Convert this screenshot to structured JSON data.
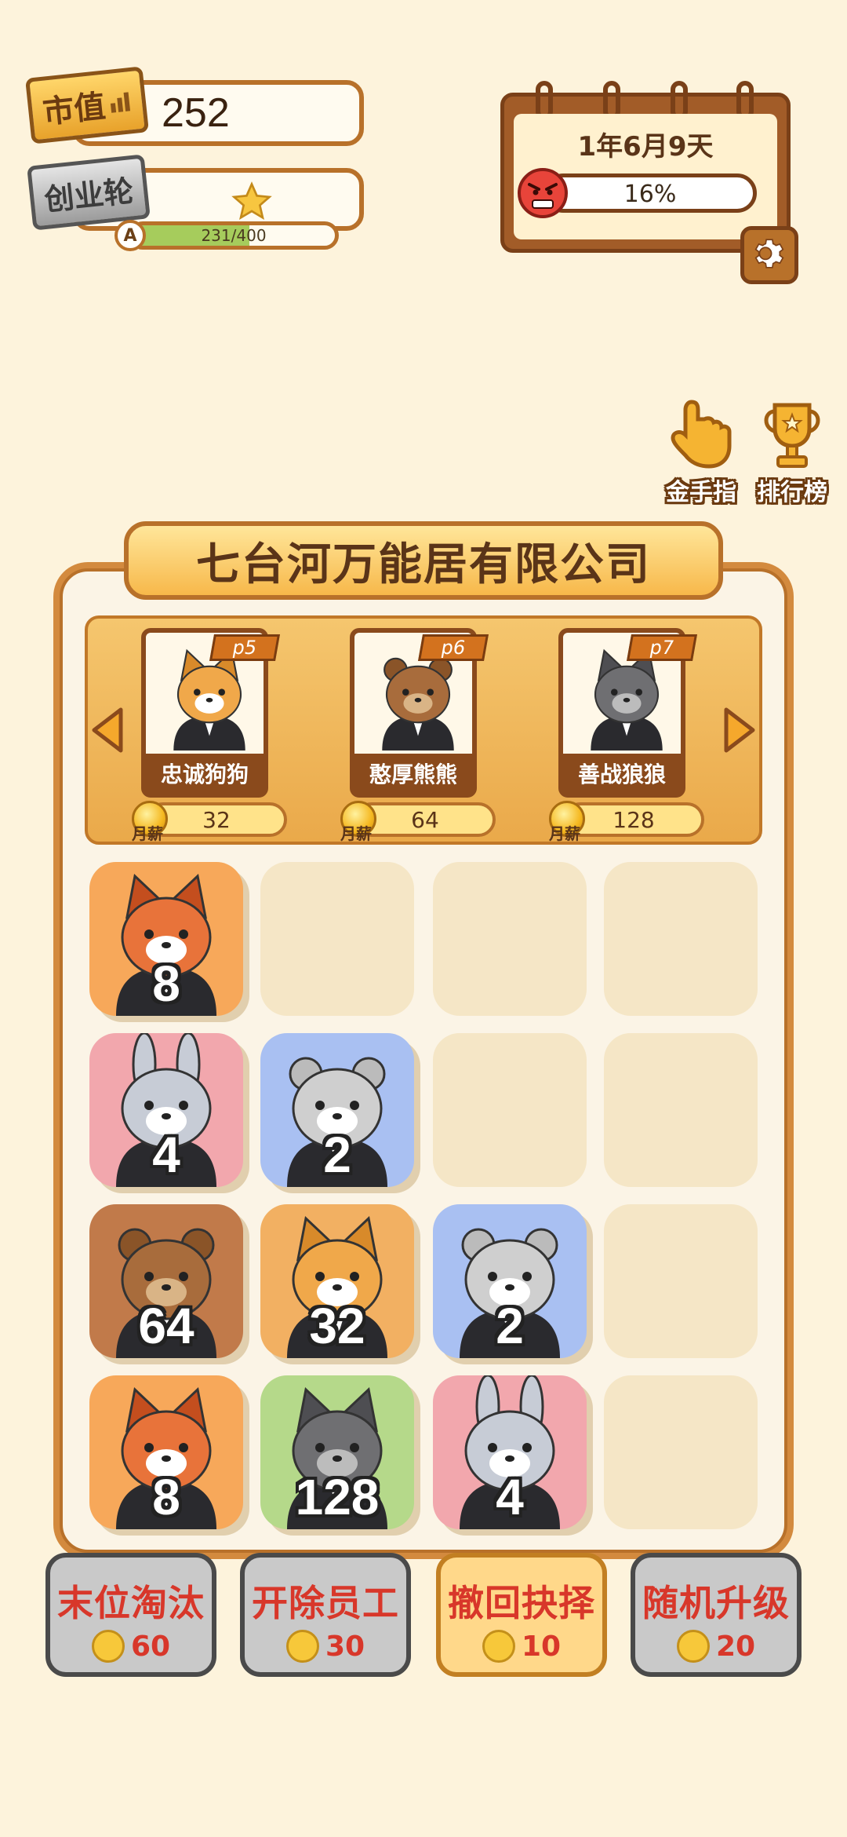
{
  "hud": {
    "market_value_label": "市值",
    "market_value": "252",
    "round_label": "创业轮",
    "rank_letter": "A",
    "progress_text": "231/400",
    "progress_fraction": 0.5775
  },
  "calendar": {
    "date_text": "1年6月9天",
    "anger_percent_text": "16%",
    "anger_fraction": 0.16
  },
  "side_buttons": {
    "golden_finger": "金手指",
    "leaderboard": "排行榜"
  },
  "company": {
    "title": "七台河万能居有限公司",
    "salary_label": "月薪",
    "staff": [
      {
        "level": "p5",
        "name": "忠诚狗狗",
        "salary": "32",
        "animal": "shiba"
      },
      {
        "level": "p6",
        "name": "憨厚熊熊",
        "salary": "64",
        "animal": "bear"
      },
      {
        "level": "p7",
        "name": "善战狼狼",
        "salary": "128",
        "animal": "wolf"
      }
    ]
  },
  "board": {
    "tiles": [
      {
        "row": 0,
        "col": 0,
        "value": "8",
        "animal": "red-panda",
        "color": "#f7a85a"
      },
      {
        "row": 1,
        "col": 0,
        "value": "4",
        "animal": "rabbit",
        "color": "#f2a7ad"
      },
      {
        "row": 1,
        "col": 1,
        "value": "2",
        "animal": "hamster",
        "color": "#a9c0f2"
      },
      {
        "row": 2,
        "col": 0,
        "value": "64",
        "animal": "bear",
        "color": "#c17a4a"
      },
      {
        "row": 2,
        "col": 1,
        "value": "32",
        "animal": "shiba",
        "color": "#f2b062"
      },
      {
        "row": 2,
        "col": 2,
        "value": "2",
        "animal": "hamster",
        "color": "#a9c0f2"
      },
      {
        "row": 3,
        "col": 0,
        "value": "8",
        "animal": "red-panda",
        "color": "#f7a85a"
      },
      {
        "row": 3,
        "col": 1,
        "value": "128",
        "animal": "wolf",
        "color": "#b5d98a"
      },
      {
        "row": 3,
        "col": 2,
        "value": "4",
        "animal": "rabbit",
        "color": "#f2a7ad"
      }
    ]
  },
  "actions": [
    {
      "label": "末位淘汰",
      "cost": "60",
      "active": false
    },
    {
      "label": "开除员工",
      "cost": "30",
      "active": false
    },
    {
      "label": "撤回抉择",
      "cost": "10",
      "active": true
    },
    {
      "label": "随机升级",
      "cost": "20",
      "active": false
    }
  ],
  "icons": {
    "gear": "gear-icon",
    "angry_face": "angry-face-icon",
    "star": "star-icon",
    "hand": "pointing-hand-icon",
    "trophy": "trophy-icon",
    "smile": "smile-coin-icon"
  }
}
